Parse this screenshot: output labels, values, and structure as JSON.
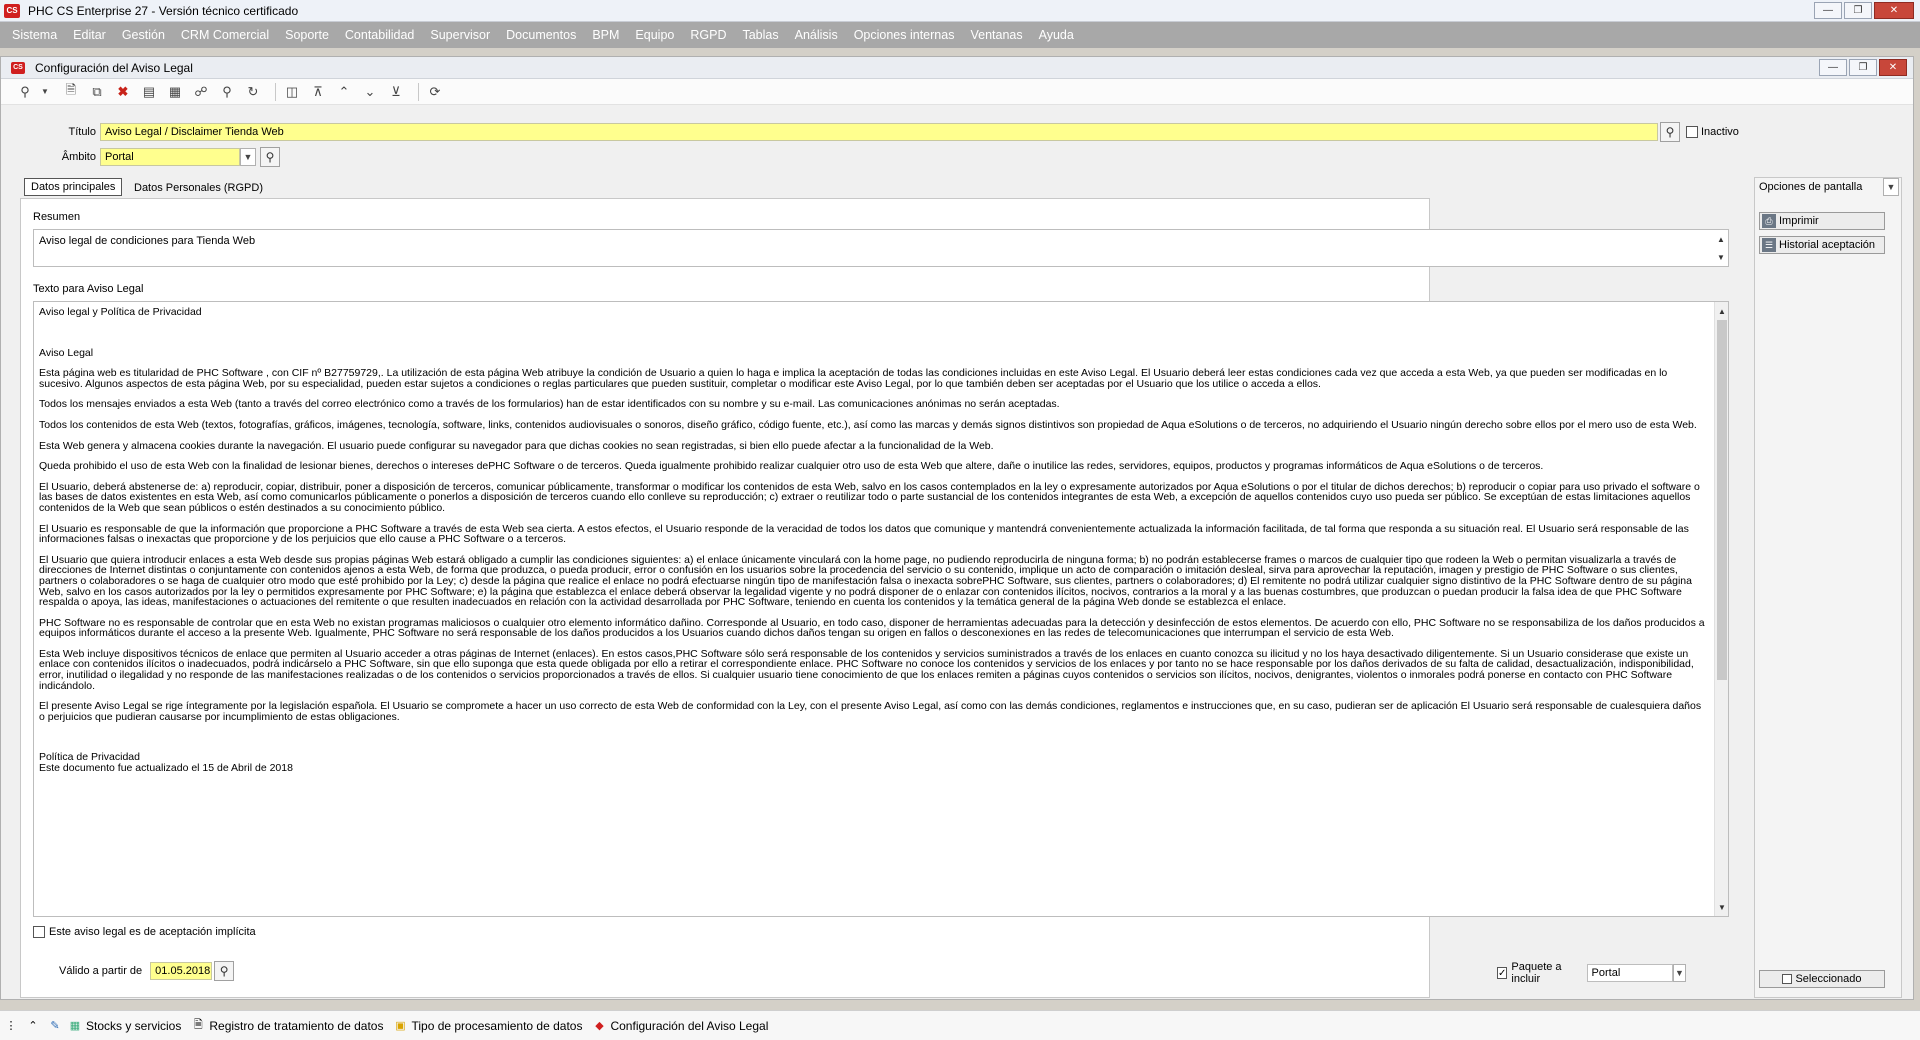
{
  "app": {
    "title": "PHC CS Enterprise 27 - Versión técnico certificado",
    "logo_text": "CS"
  },
  "menu": [
    "Sistema",
    "Editar",
    "Gestión",
    "CRM Comercial",
    "Soporte",
    "Contabilidad",
    "Supervisor",
    "Documentos",
    "BPM",
    "Equipo",
    "RGPD",
    "Tablas",
    "Análisis",
    "Opciones internas",
    "Ventanas",
    "Ayuda"
  ],
  "window": {
    "title": "Configuración del Aviso Legal",
    "logo_text": "CS"
  },
  "toolbar_icons": [
    "search-icon",
    "dropdown-arrow-icon",
    "new-document-icon",
    "copy-document-icon",
    "delete-icon",
    "list-view-icon",
    "grid-view-icon",
    "hierarchy-icon",
    "find-icon",
    "refresh-icon",
    "preview-icon",
    "first-record-icon",
    "previous-record-icon",
    "next-record-icon",
    "last-record-icon",
    "reload-icon"
  ],
  "form": {
    "titulo_label": "Título",
    "titulo_value": "Aviso Legal / Disclaimer Tienda Web",
    "inactivo_label": "Inactivo",
    "inactivo_checked": false,
    "ambito_label": "Âmbito",
    "ambito_value": "Portal"
  },
  "tabs": [
    {
      "label": "Datos principales",
      "active": true
    },
    {
      "label": "Datos Personales (RGPD)",
      "active": false
    }
  ],
  "resumen": {
    "label": "Resumen",
    "value": "Aviso legal de condiciones para Tienda Web"
  },
  "texto": {
    "label": "Texto para Aviso Legal",
    "paragraphs": [
      "Aviso legal y Política de Privacidad",
      "",
      "Aviso Legal",
      "Esta página web es titularidad de PHC Software , con CIF nº B27759729,. La utilización de esta página Web atribuye la condición de Usuario a quien lo haga e implica la aceptación de todas las condiciones incluidas en este Aviso Legal. El Usuario deberá leer estas condiciones cada vez que acceda a esta Web, ya que pueden ser modificadas en lo sucesivo. Algunos aspectos de esta página Web, por su especialidad, pueden estar sujetos a condiciones o reglas particulares que pueden sustituir, completar o modificar este Aviso Legal, por lo que también deben ser aceptadas por el Usuario que los utilice o acceda a ellos.",
      "Todos los mensajes enviados a esta Web (tanto a través del correo electrónico como a través de los formularios) han de estar identificados con su nombre y su e-mail. Las comunicaciones anónimas no serán aceptadas.",
      "Todos los contenidos de esta Web (textos, fotografías, gráficos, imágenes, tecnología, software, links, contenidos audiovisuales o sonoros, diseño gráfico, código fuente, etc.), así como las marcas y demás signos distintivos son propiedad de Aqua eSolutions o de terceros, no adquiriendo el Usuario ningún derecho sobre ellos por el mero uso de esta Web.",
      "Esta Web genera y almacena cookies durante la navegación. El usuario puede configurar su navegador para que dichas cookies no sean registradas, si bien ello puede afectar a la funcionalidad de la Web.",
      "Queda prohibido el uso de esta Web con la finalidad de lesionar bienes, derechos o intereses dePHC Software o de terceros. Queda igualmente prohibido realizar cualquier otro uso de esta Web que altere, dañe o inutilice las redes, servidores, equipos, productos y programas informáticos de Aqua eSolutions o de terceros.",
      "El Usuario, deberá abstenerse de: a) reproducir, copiar, distribuir, poner a disposición de terceros, comunicar públicamente, transformar o modificar los contenidos de esta Web, salvo en los casos contemplados en la ley o expresamente autorizados por Aqua eSolutions o por el titular de dichos derechos; b) reproducir o copiar para uso privado el software o las bases de datos existentes en esta Web, así como comunicarlos públicamente o ponerlos a disposición de terceros cuando ello conlleve su reproducción; c) extraer o reutilizar todo o parte sustancial de los contenidos integrantes de esta Web, a excepción de aquellos contenidos cuyo uso pueda ser público. Se exceptúan de estas limitaciones aquellos contenidos de la Web que sean públicos o estén destinados a su conocimiento público.",
      "El Usuario es responsable de que la información que proporcione a PHC Software a través de esta Web sea cierta. A estos efectos, el Usuario responde de la veracidad de todos los datos que comunique y mantendrá convenientemente actualizada la información facilitada, de tal forma que responda a su situación real. El Usuario será responsable de las informaciones falsas o inexactas que proporcione y de los perjuicios que ello cause a PHC Software o a terceros.",
      "El Usuario que quiera introducir enlaces a esta Web desde sus propias páginas Web estará obligado a cumplir las condiciones siguientes: a) el enlace únicamente vinculará con la home page, no pudiendo reproducirla de ninguna forma; b) no podrán establecerse frames o marcos de cualquier tipo que rodeen la Web o permitan visualizarla a través de direcciones de Internet distintas o conjuntamente con contenidos ajenos a esta Web, de forma que produzca, o pueda producir, error o confusión en los usuarios sobre la procedencia del servicio o su contenido, implique un acto de comparación o imitación desleal, sirva para aprovechar la reputación, imagen y prestigio de PHC Software o sus clientes, partners o colaboradores o se haga de cualquier otro modo que esté prohibido por la Ley; c) desde la página que realice el enlace no podrá efectuarse ningún tipo de manifestación falsa o inexacta sobrePHC Software, sus clientes, partners o colaboradores; d) El remitente no podrá utilizar cualquier signo distintivo de la PHC Software dentro de su página Web, salvo en los casos autorizados por la ley o permitidos expresamente por PHC Software; e) la página que establezca el enlace deberá observar la legalidad vigente y no podrá disponer de o enlazar con contenidos ilícitos, nocivos, contrarios a la moral y a las buenas costumbres, que produzcan o puedan producir la falsa idea de que PHC Software respalda o apoya, las ideas, manifestaciones o actuaciones del remitente o que resulten inadecuados en relación con la actividad desarrollada por PHC Software, teniendo en cuenta los contenidos y la temática general de la página Web donde se establezca el enlace.",
      "PHC Software no es responsable de controlar que en esta Web no existan programas maliciosos o cualquier otro elemento informático dañino. Corresponde al Usuario, en todo caso, disponer de herramientas adecuadas para la detección y desinfección de estos elementos. De acuerdo con ello, PHC Software no se responsabiliza de los daños producidos a equipos informáticos durante el acceso a la presente Web. Igualmente, PHC Software no será responsable de los daños producidos a los Usuarios cuando dichos daños tengan su origen en fallos o desconexiones en las redes de telecomunicaciones que interrumpan el servicio de esta Web.",
      "Esta Web incluye dispositivos técnicos de enlace que permiten al Usuario acceder a otras páginas de Internet (enlaces). En estos casos,PHC Software sólo será responsable de los contenidos y servicios suministrados a través de los enlaces en cuanto conozca su ilicitud y no los haya desactivado diligentemente. Si un Usuario considerase que existe un enlace con contenidos ilícitos o inadecuados, podrá indicárselo a PHC Software, sin que ello suponga que esta quede obligada por ello a retirar el correspondiente enlace. PHC Software no conoce los contenidos y servicios de los enlaces y por tanto no se hace responsable por los daños derivados de su falta de calidad, desactualización, indisponibilidad, error, inutilidad o ilegalidad y no responde de las manifestaciones realizadas o de los contenidos o servicios proporcionados a través de ellos. Si cualquier usuario tiene conocimiento de que los enlaces remiten a páginas cuyos contenidos o servicios son ilícitos, nocivos, denigrantes, violentos o inmorales podrá ponerse en contacto con PHC Software indicándolo.",
      "El presente Aviso Legal se rige íntegramente por la legislación española. El Usuario se compromete a hacer un uso correcto de esta Web de conformidad con la Ley, con el presente Aviso Legal, así como con las demás condiciones, reglamentos e instrucciones que, en su caso, pudieran ser de aplicación El Usuario será responsable de cualesquiera daños o perjuicios que pudieran causarse por incumplimiento de estas obligaciones.",
      "",
      "Política de Privacidad\nEste documento fue actualizado el 15 de Abril de 2018"
    ]
  },
  "bottom": {
    "implicit_label": "Este aviso legal es de aceptación implícita",
    "implicit_checked": false,
    "valido_label": "Válido a partir de",
    "valido_value": "01.05.2018",
    "paquete_label": "Paquete a incluir",
    "paquete_checked": true,
    "paquete_value": "Portal"
  },
  "right_panel": {
    "options_label": "Opciones de pantalla",
    "buttons": [
      "Imprimir",
      "Historial aceptación"
    ],
    "seleccionado_label": "Seleccionado"
  },
  "taskbar": {
    "items": [
      "Stocks y servicios",
      "Registro de tratamiento de datos",
      "Tipo de procesamiento de datos",
      "Configuración del Aviso Legal"
    ]
  },
  "colors": {
    "menubar": "#a8a8a8",
    "field_yellow": "#ffff8e",
    "logo_red": "#d01f1f"
  }
}
